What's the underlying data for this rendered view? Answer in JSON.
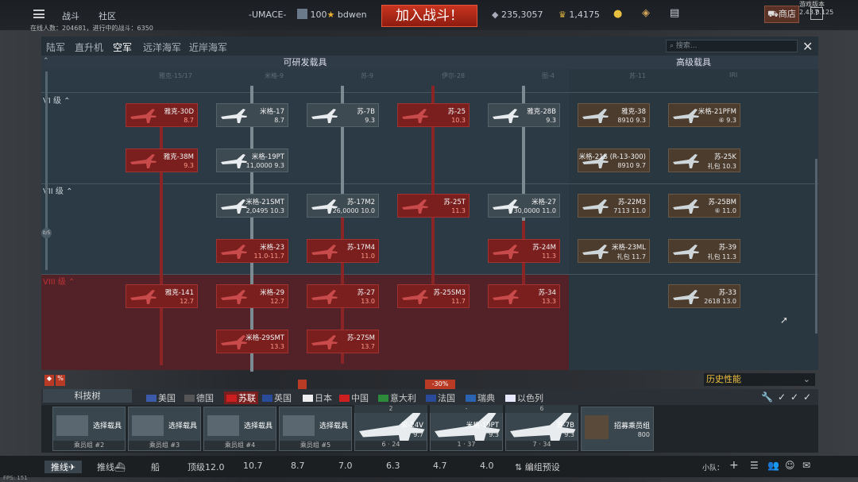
{
  "topbar": {
    "battle_tab": "战斗",
    "community_tab": "社区",
    "squad_tag": "-UMACE-",
    "level": "100",
    "username": "bdwen",
    "battle_button": "加入战斗！",
    "silver_lions": "235,3057",
    "golden_eagles": "1,4175",
    "shop_button": "商店",
    "help_button": "?",
    "version": "游戏版本 2.43.0.125",
    "online": "在线人数：204681，进行中的战斗：6350"
  },
  "tabs": [
    "陆军",
    "直升机",
    "空军",
    "远洋海军",
    "近岸海军"
  ],
  "active_tab": "空军",
  "search": {
    "placeholder": "搜索..."
  },
  "column_headers": {
    "research": "可研发载具",
    "premium": "高级载具"
  },
  "ranks": {
    "r6": "VI 级",
    "r7": "VII 级",
    "r8": "VIII 级"
  },
  "ghost_row": [
    "雅克-15/17",
    "米格-9",
    "苏-9",
    "伊尔-28",
    "图-4",
    "苏-11",
    "IRI"
  ],
  "vehicles": [
    {
      "name": "雅克-30D",
      "br": "8.7",
      "state": "red"
    },
    {
      "name": "米格-17",
      "br": "8.7",
      "state": "owned"
    },
    {
      "name": "苏-7B",
      "br": "9.3",
      "state": "owned"
    },
    {
      "name": "苏-25",
      "br": "10.3",
      "state": "red"
    },
    {
      "name": "雅克-28B",
      "br": "9.3",
      "state": "owned"
    },
    {
      "name": "雅克-38M",
      "br": "9.3",
      "state": "red"
    },
    {
      "name": "米格-19PT",
      "br": "11,0000 9.3",
      "state": "owned"
    },
    {
      "name": "米格-21SMT",
      "br": "2,0495 10.3",
      "state": "owned"
    },
    {
      "name": "苏-17M2",
      "br": "26,0000 10.0",
      "state": "owned"
    },
    {
      "name": "苏-25T",
      "br": "11.3",
      "state": "red"
    },
    {
      "name": "米格-27",
      "br": "30,0000 11.0",
      "state": "owned"
    },
    {
      "name": "米格-23",
      "br": "11.0-11.7",
      "state": "red"
    },
    {
      "name": "苏-17M4",
      "br": "11.0",
      "state": "red"
    },
    {
      "name": "苏-24M",
      "br": "11.3",
      "state": "red"
    },
    {
      "name": "雅克-141",
      "br": "12.7",
      "state": "red"
    },
    {
      "name": "米格-29",
      "br": "12.7",
      "state": "red"
    },
    {
      "name": "苏-27",
      "br": "13.0",
      "state": "red"
    },
    {
      "name": "苏-25SM3",
      "br": "11.7",
      "state": "red"
    },
    {
      "name": "苏-34",
      "br": "13.3",
      "state": "red"
    },
    {
      "name": "米格-29SMT",
      "br": "13.3",
      "state": "red"
    },
    {
      "name": "苏-27SM",
      "br": "13.7",
      "state": "red"
    }
  ],
  "premium": [
    {
      "name": "雅克-38",
      "br": "8910 9.3"
    },
    {
      "name": "米格-21PFM",
      "br": "⑥ 9.3"
    },
    {
      "name": "米格-21S (R-13-300)",
      "br": "8910 9.7"
    },
    {
      "name": "苏-25K",
      "br": "礼包 10.3"
    },
    {
      "name": "苏-22M3",
      "br": "7113 11.0"
    },
    {
      "name": "苏-25BM",
      "br": "⑥ 11.0"
    },
    {
      "name": "米格-23ML",
      "br": "礼包 11.7"
    },
    {
      "name": "苏-39",
      "br": "礼包 11.3"
    },
    {
      "name": "苏-33",
      "br": "2618 13.0"
    }
  ],
  "history_perf": "历史性能",
  "tech_tree_button": "科技树",
  "nations": [
    {
      "name": "美国",
      "color": "#3b5aa8"
    },
    {
      "name": "德国",
      "color": "#555555"
    },
    {
      "name": "苏联",
      "color": "#cc2020"
    },
    {
      "name": "英国",
      "color": "#2a4a9a"
    },
    {
      "name": "日本",
      "color": "#eeeeee"
    },
    {
      "name": "中国",
      "color": "#cc2020"
    },
    {
      "name": "意大利",
      "color": "#2c8a3a"
    },
    {
      "name": "法国",
      "color": "#2a4a9a"
    },
    {
      "name": "瑞典",
      "color": "#2a63b0"
    },
    {
      "name": "以色列",
      "color": "#e8e8ff"
    }
  ],
  "discount": "-30%",
  "crew_slots": [
    {
      "label": "乘员组 #2",
      "text": "选择载具"
    },
    {
      "label": "乘员组 #3",
      "text": "选择载具"
    },
    {
      "label": "乘员组 #4",
      "text": "选择载具"
    },
    {
      "label": "乘员组 #5",
      "text": "选择载具"
    }
  ],
  "crew_vehicles": [
    {
      "count": "2",
      "name": "米-24V",
      "br": "9.7",
      "crew": "6",
      "extra": "24"
    },
    {
      "count": "-",
      "name": "米格-19PT",
      "br": "9.3",
      "crew": "1",
      "extra": "37"
    },
    {
      "count": "6",
      "name": "苏-7B",
      "br": "9.3",
      "crew": "7",
      "extra": "34"
    }
  ],
  "recruit": {
    "text": "招募乘员组",
    "cost": "800"
  },
  "bottom": {
    "preset1": "推线",
    "preset2": "推线",
    "ship": "船",
    "top": "顶级12.0",
    "b1": "10.7",
    "b2": "8.7",
    "b3": "7.0",
    "b4": "6.3",
    "b5": "4.7",
    "b6": "4.0",
    "presets": "编组预设",
    "squad": "小队："
  },
  "fps": "FPS: 151"
}
